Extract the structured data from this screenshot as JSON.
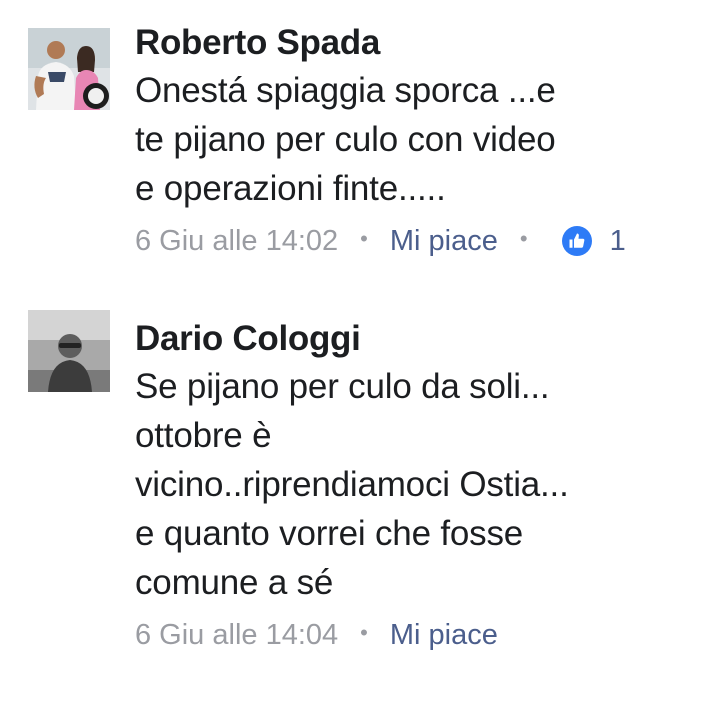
{
  "comments": [
    {
      "author": "Roberto Spada",
      "text": "Onestá spiaggia sporca ...e\nte pijano per culo con video\ne operazioni finte.....",
      "time": "6 Giu alle 14:02",
      "separator": "•",
      "like_label": "Mi piace",
      "reaction_icon": "thumbs-up-icon",
      "like_count": "1"
    },
    {
      "author": "Dario Cologgi",
      "text": "Se pijano per culo da soli...\nottobre è\nvicino..riprendiamoci Ostia...\ne quanto vorrei che fosse\ncomune a sé",
      "time": "6 Giu alle 14:04",
      "separator": "•",
      "like_label": "Mi piace"
    }
  ],
  "colors": {
    "author": "#1c1e21",
    "meta": "#9a9ca2",
    "link": "#4b5e8c",
    "reaction": "#2e7bf6"
  }
}
